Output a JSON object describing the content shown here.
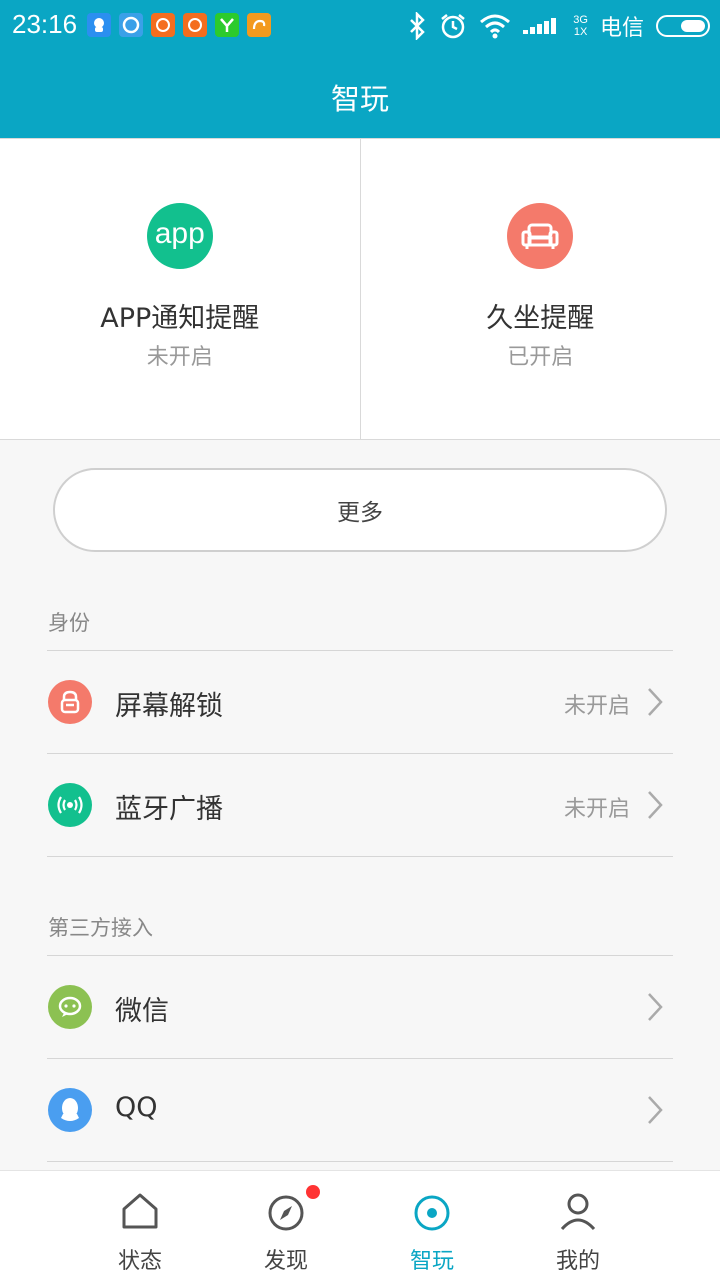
{
  "status_bar": {
    "time": "23:16",
    "notification_icons": [
      "qq-notify-icon",
      "browser-icon",
      "mi-app-icon",
      "mi-app-icon-2",
      "yixin-icon",
      "uc-browser-icon"
    ],
    "network_type_top": "3G",
    "network_type_bottom": "1X",
    "carrier": "电信"
  },
  "header": {
    "title": "智玩"
  },
  "cards": [
    {
      "icon": "app-icon",
      "icon_text": "app",
      "icon_color": "#12c08e",
      "title": "APP通知提醒",
      "status": "未开启"
    },
    {
      "icon": "sofa-icon",
      "icon_color": "#f47a6b",
      "title": "久坐提醒",
      "status": "已开启"
    }
  ],
  "more_button": {
    "label": "更多"
  },
  "sections": {
    "identity": {
      "header": "身份",
      "items": [
        {
          "label": "屏幕解锁",
          "status": "未开启",
          "icon": "lock-icon",
          "icon_color": "#f47a6b"
        },
        {
          "label": "蓝牙广播",
          "status": "未开启",
          "icon": "broadcast-icon",
          "icon_color": "#12c08e"
        }
      ]
    },
    "third_party": {
      "header": "第三方接入",
      "items": [
        {
          "label": "微信",
          "icon": "wechat-icon",
          "icon_color": "#8cc152"
        },
        {
          "label": "QQ",
          "icon": "qq-icon",
          "icon_color": "#4a9ef0"
        }
      ]
    }
  },
  "bottom_nav": {
    "items": [
      {
        "label": "状态",
        "icon": "home-icon"
      },
      {
        "label": "发现",
        "icon": "compass-icon",
        "badge": true
      },
      {
        "label": "智玩",
        "icon": "target-icon",
        "active": true
      },
      {
        "label": "我的",
        "icon": "person-icon"
      }
    ]
  },
  "colors": {
    "accent": "#0aa6c4",
    "badge": "#ff3333"
  }
}
